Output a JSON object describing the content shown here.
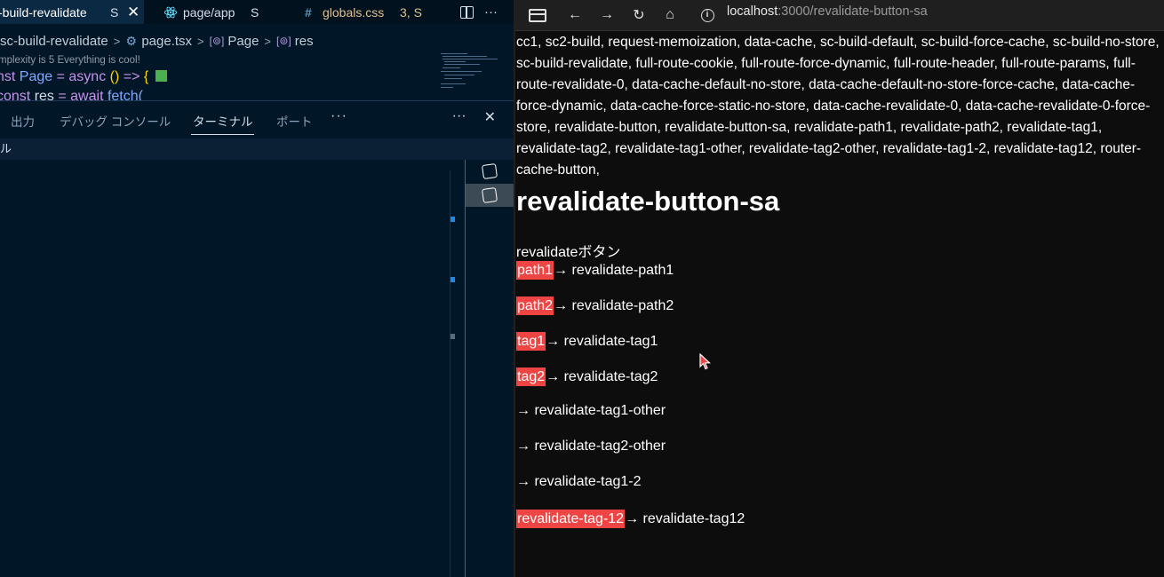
{
  "vscode": {
    "tabs": [
      {
        "label": "-build-revalidate",
        "badge": "S",
        "close": "✕"
      },
      {
        "label": "page/app",
        "badge": "S"
      },
      {
        "label": "globals.css",
        "badge": "3, S",
        "prefix": "#"
      }
    ],
    "breadcrumb": {
      "folder": "sc-build-revalidate",
      "file": "page.tsx",
      "symbol1": "Page",
      "symbol2": "res"
    },
    "codelens": "mplexity is 5 Everything is cool!",
    "code_line1": {
      "kw": "nst ",
      "name": "Page",
      "eq": " = ",
      "async": "async",
      "paren": " () ",
      "arrow": "=>",
      "brace": " {"
    },
    "code_line2": {
      "kw": "const ",
      "var": "res",
      "eq": " = ",
      "await": "await ",
      "fn": "fetch("
    },
    "panel": {
      "tabs": [
        "出力",
        "デバッグ コンソール",
        "ターミナル",
        "ポート"
      ],
      "active_tab": "ターミナル",
      "more": "···",
      "right_more": "···",
      "close": "✕",
      "terminal_header": "ル"
    }
  },
  "browser": {
    "url_host": "localhost",
    "url_path": ":3000/revalidate-button-sa",
    "nav_links": "cc1, sc2-build, request-memoization, data-cache, sc-build-default, sc-build-force-cache, sc-build-no-store, sc-build-revalidate, full-route-cookie, full-route-force-dynamic, full-route-header, full-route-params, full-route-revalidate-0, data-cache-default-no-store, data-cache-default-no-store-force-cache, data-cache-force-dynamic, data-cache-force-static-no-store, data-cache-revalidate-0, data-cache-revalidate-0-force-store, revalidate-button, revalidate-button-sa, revalidate-path1, revalidate-path2, revalidate-tag1, revalidate-tag2, revalidate-tag1-other, revalidate-tag2-other, revalidate-tag1-2, revalidate-tag12, router-cache-button,",
    "heading": "revalidate-button-sa",
    "description": "revalidateボタン",
    "rows": [
      {
        "button": "path1",
        "text": "→ revalidate-path1"
      },
      {
        "button": "path2",
        "text": "→ revalidate-path2"
      },
      {
        "button": "tag1",
        "text": "→ revalidate-tag1"
      },
      {
        "button": "tag2",
        "text": "→ revalidate-tag2"
      },
      {
        "button": "",
        "text": "→ revalidate-tag1-other"
      },
      {
        "button": "",
        "text": "→ revalidate-tag2-other"
      },
      {
        "button": "",
        "text": "→ revalidate-tag1-2"
      },
      {
        "button": "revalidate-tag-12",
        "text": "→ revalidate-tag12"
      }
    ],
    "colors": {
      "button_bg": "#ef4444",
      "page_bg": "#0d0d0d"
    }
  }
}
